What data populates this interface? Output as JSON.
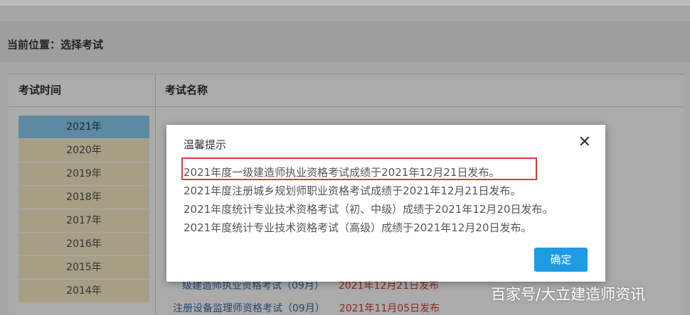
{
  "breadcrumb": {
    "label": "当前位置：选择考试"
  },
  "columns": {
    "time": "考试时间",
    "name": "考试名称"
  },
  "years": [
    "2021年",
    "2020年",
    "2019年",
    "2018年",
    "2017年",
    "2016年",
    "2015年",
    "2014年"
  ],
  "selected_year": "2021年",
  "background_rows": [
    {
      "name": "级建造师执业资格考试（09月）",
      "date": "2021年12月21日发布"
    },
    {
      "name": "注册设备监理师资格考试（09月）",
      "date": "2021年11月05日发布"
    }
  ],
  "dialog": {
    "title": "温馨提示",
    "close": "✕",
    "lines": [
      "2021年度一级建造师执业资格考试成绩于2021年12月21日发布。",
      "2021年度注册城乡规划师职业资格考试成绩于2021年12月21日发布。",
      "2021年度统计专业技术资格考试（初、中级）成绩于2021年12月20日发布。",
      "2021年度统计专业技术资格考试（高级）成绩于2021年12月20日发布。"
    ],
    "ok_label": "确定"
  },
  "watermark": "百家号/大立建造师资讯",
  "colors": {
    "accent": "#1e9be3",
    "highlight": "#d83a3a"
  }
}
